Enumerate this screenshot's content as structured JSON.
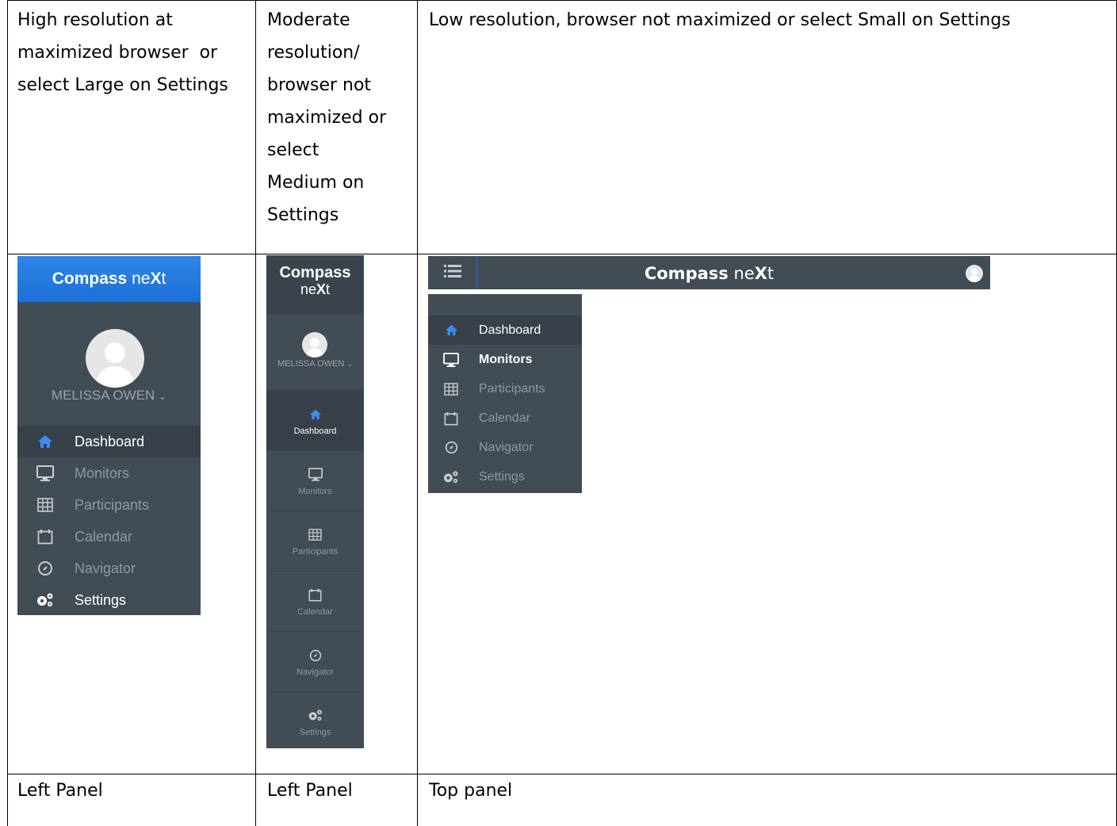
{
  "table": {
    "headers": [
      "High resolution at maximized browser  or select Large on Settings",
      "Moderate resolution/ browser not maximized or select Medium on Settings",
      "Low resolution, browser not maximized or select Small on Settings"
    ],
    "header_lines": {
      "col1": [
        "High resolution at",
        "maximized browser  or",
        "select Large on Settings"
      ],
      "col2": [
        "Moderate",
        "resolution/",
        "browser not",
        "maximized or",
        "select",
        "Medium on",
        "Settings"
      ],
      "col3": [
        "Low resolution, browser not maximized or select Small on Settings"
      ]
    },
    "footers": [
      "Left Panel",
      "Left Panel",
      "Top panel"
    ]
  },
  "brand": {
    "strong": "Compass",
    "light_pre": "ne",
    "light_x": "X",
    "light_post": "t"
  },
  "user": {
    "name": "MELISSA OWEN"
  },
  "nav": {
    "dashboard": "Dashboard",
    "monitors": "Monitors",
    "participants": "Participants",
    "calendar": "Calendar",
    "navigator": "Navigator",
    "settings": "Settings"
  },
  "icons": [
    "home-icon",
    "monitor-icon",
    "grid-icon",
    "calendar-icon",
    "compass-icon",
    "gears-icon",
    "user-icon",
    "list-icon",
    "chevron-down-icon"
  ],
  "colors": {
    "panel_bg": "#424c55",
    "active_bg": "#38414a",
    "brand_blue": "#1c6fd6",
    "accent_blue": "#3b8ef0",
    "muted_text": "#8e98a2"
  }
}
